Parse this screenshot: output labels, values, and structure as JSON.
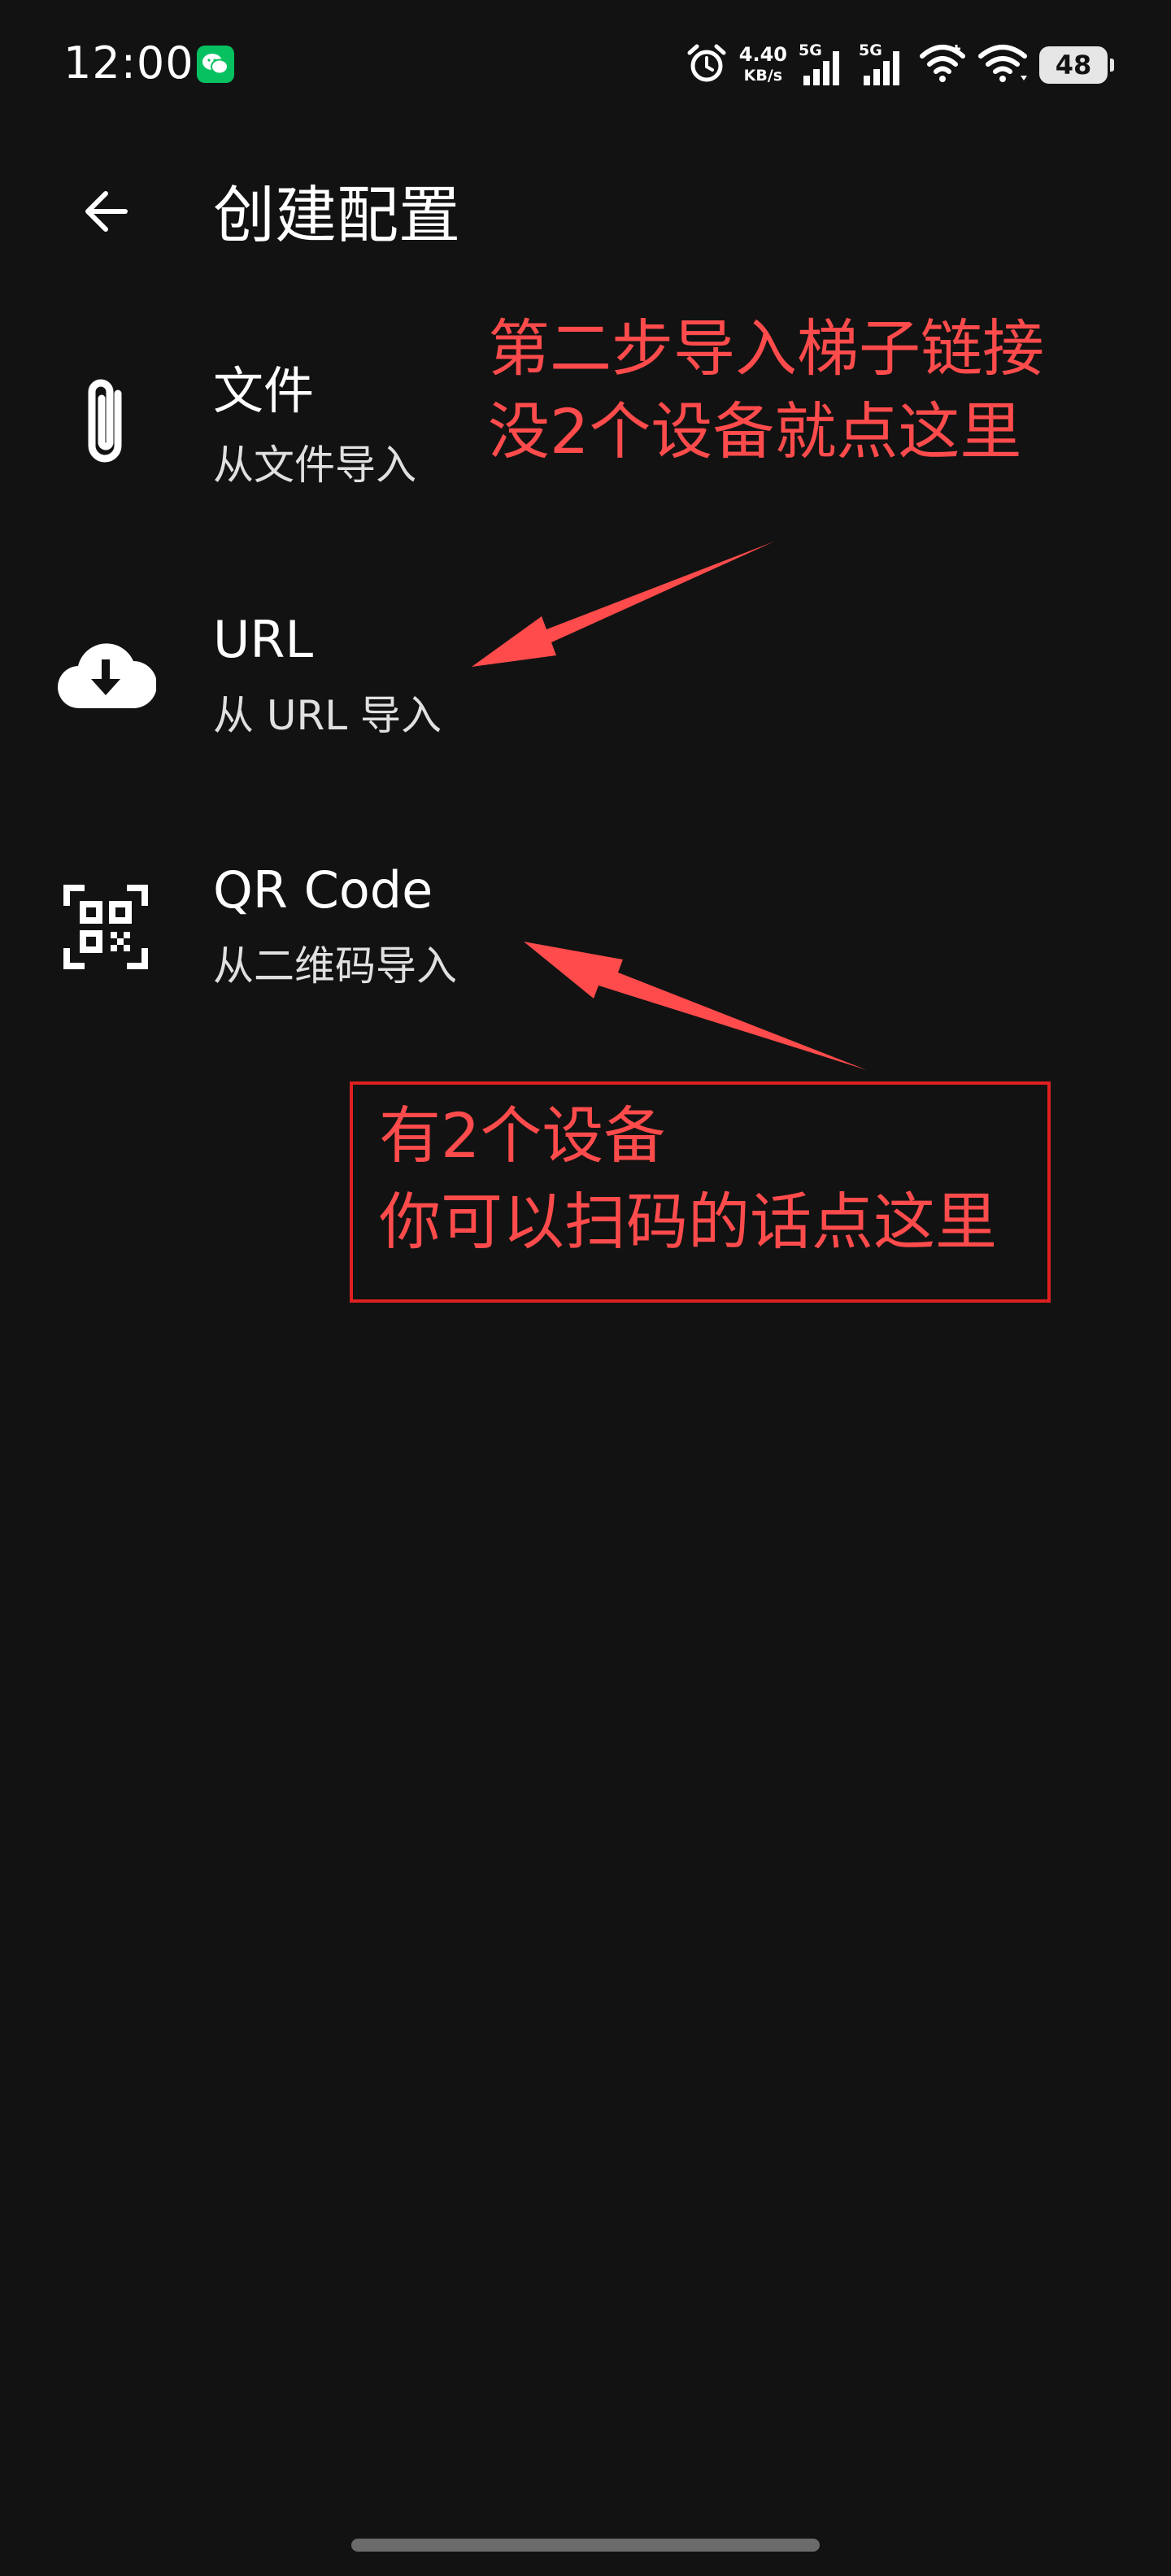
{
  "status_bar": {
    "time": "12:00",
    "net_speed_value": "4.40",
    "net_speed_unit": "KB/s",
    "signal_1_label": "5G",
    "signal_2_label": "5G",
    "battery": "48",
    "icons": [
      "wechat-icon",
      "alarm-icon",
      "signal-icon",
      "wifi-icon",
      "battery-icon"
    ],
    "colors": {
      "wechat": "#07c160"
    }
  },
  "app_bar": {
    "title": "创建配置",
    "back_icon": "arrow-left-icon"
  },
  "menu": {
    "items": [
      {
        "title": "文件",
        "subtitle": "从文件导入",
        "icon": "paperclip-icon"
      },
      {
        "title": "URL",
        "subtitle": "从 URL 导入",
        "icon": "cloud-download-icon"
      },
      {
        "title": "QR Code",
        "subtitle": "从二维码导入",
        "icon": "qr-code-scan-icon"
      }
    ]
  },
  "annotations": {
    "color": "#ff4b4b",
    "top_line_1": "第二步导入梯子链接",
    "top_line_2": "没2个设备就点这里",
    "box_line_1": "有2个设备",
    "box_line_2": "你可以扫码的话点这里"
  }
}
